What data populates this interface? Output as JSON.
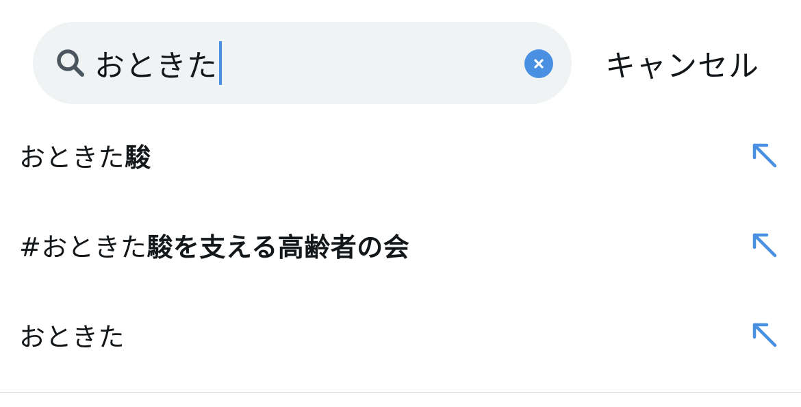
{
  "search": {
    "query": "おときた"
  },
  "cancel_label": "キャンセル",
  "suggestions": [
    {
      "prefix": "おときた",
      "highlight": "駿"
    },
    {
      "prefix": "#おときた",
      "highlight": "駿を支える高齢者の会"
    },
    {
      "prefix": "おときた",
      "highlight": ""
    }
  ],
  "colors": {
    "accent": "#4a90e2",
    "search_bg": "#eff3f4",
    "text": "#14171a"
  },
  "icons": {
    "search": "search-icon",
    "clear": "clear-icon",
    "fill_suggestion": "arrow-up-left-icon"
  }
}
